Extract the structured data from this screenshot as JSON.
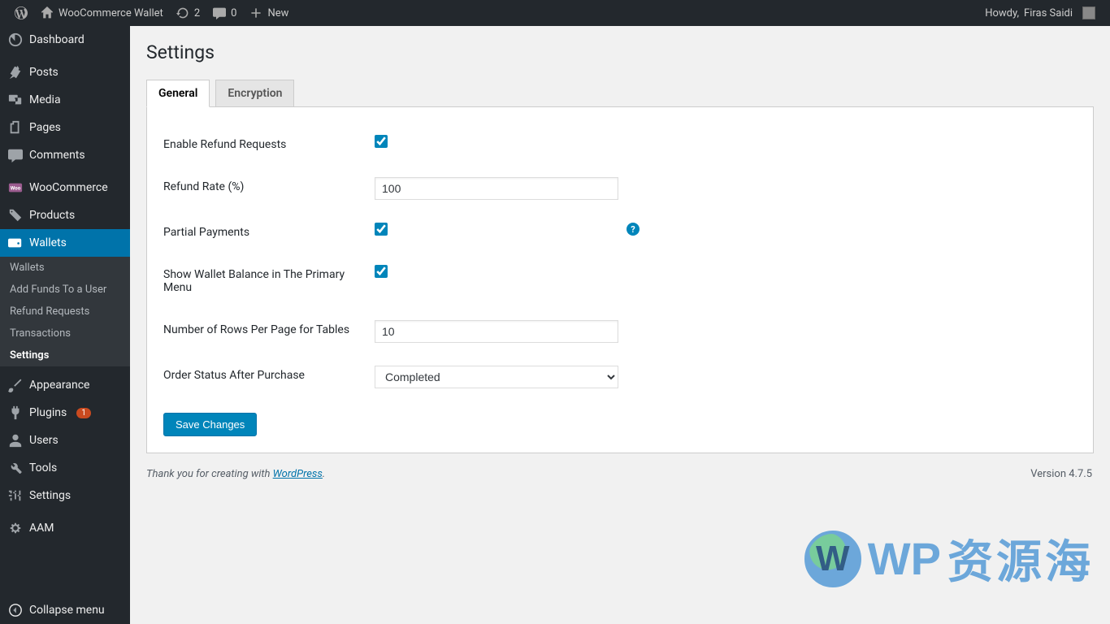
{
  "adminbar": {
    "site_name": "WooCommerce Wallet",
    "updates_count": "2",
    "comments_count": "0",
    "new_label": "New",
    "howdy_prefix": "Howdy, ",
    "user_name": "Firas Saidi"
  },
  "sidebar": {
    "items": [
      {
        "label": "Dashboard"
      },
      {
        "label": "Posts"
      },
      {
        "label": "Media"
      },
      {
        "label": "Pages"
      },
      {
        "label": "Comments"
      },
      {
        "label": "WooCommerce"
      },
      {
        "label": "Products"
      },
      {
        "label": "Wallets"
      },
      {
        "label": "Appearance"
      },
      {
        "label": "Plugins",
        "badge": "1"
      },
      {
        "label": "Users"
      },
      {
        "label": "Tools"
      },
      {
        "label": "Settings"
      },
      {
        "label": "AAM"
      },
      {
        "label": "Collapse menu"
      }
    ],
    "subitems": [
      {
        "label": "Wallets"
      },
      {
        "label": "Add Funds To a User"
      },
      {
        "label": "Refund Requests"
      },
      {
        "label": "Transactions"
      },
      {
        "label": "Settings"
      }
    ]
  },
  "page": {
    "title": "Settings",
    "tabs": [
      {
        "label": "General"
      },
      {
        "label": "Encryption"
      }
    ],
    "form": {
      "enable_refund_label": "Enable Refund Requests",
      "enable_refund_checked": true,
      "refund_rate_label": "Refund Rate (%)",
      "refund_rate_value": "100",
      "partial_payments_label": "Partial Payments",
      "partial_payments_checked": true,
      "show_balance_label": "Show Wallet Balance in The Primary Menu",
      "show_balance_checked": true,
      "rows_label": "Number of Rows Per Page for Tables",
      "rows_value": "10",
      "order_status_label": "Order Status After Purchase",
      "order_status_value": "Completed",
      "save_label": "Save Changes",
      "help_tooltip": "?"
    }
  },
  "footer": {
    "thank_you_prefix": "Thank you for creating with ",
    "wordpress_link": "WordPress",
    "thank_you_suffix": ".",
    "version": "Version 4.7.5"
  },
  "watermark": {
    "text1": "WP",
    "text2": "资源海"
  }
}
